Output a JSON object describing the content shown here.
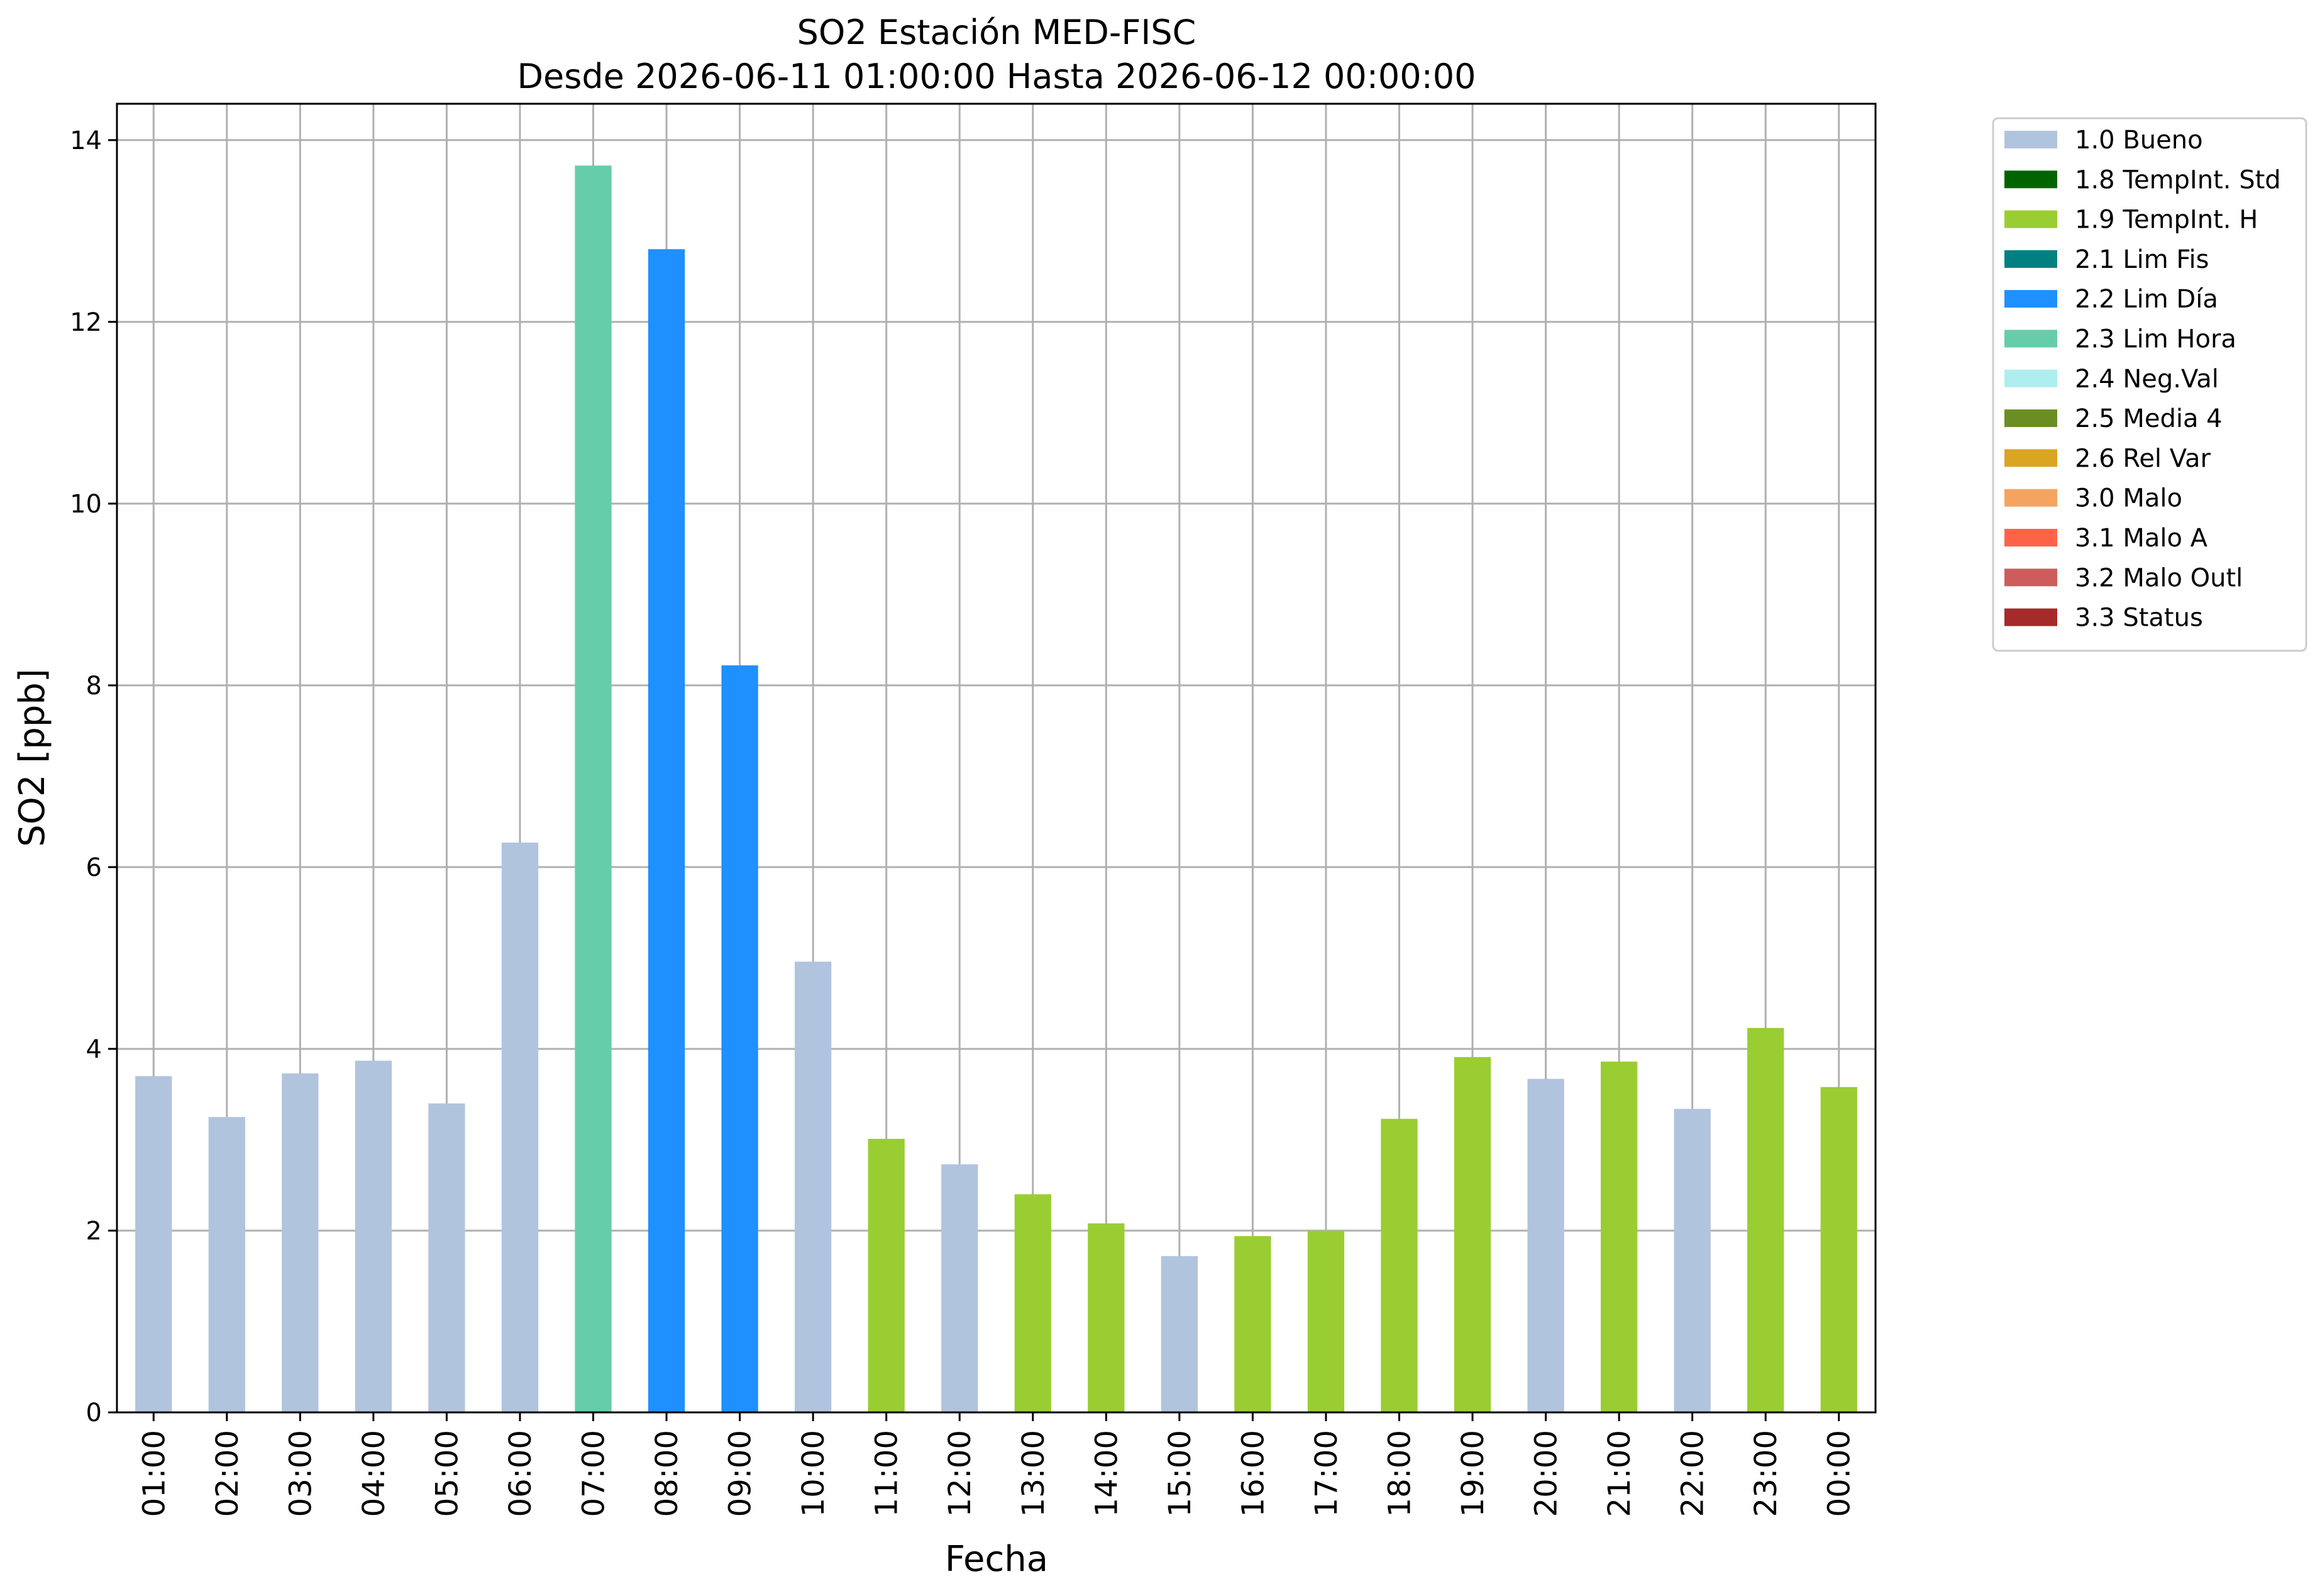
{
  "chart_data": {
    "type": "bar",
    "title_line1": "SO2 Estación MED-FISC",
    "title_line2": "Desde 2026-06-11 01:00:00 Hasta 2026-06-12 00:00:00",
    "xlabel": "Fecha",
    "ylabel": "SO2 [ppb]",
    "ylim": [
      0,
      14.4
    ],
    "yticks": [
      0,
      2,
      4,
      6,
      8,
      10,
      12,
      14
    ],
    "grid": true,
    "legend_position": "outside-right-top",
    "categories": [
      "01:00",
      "02:00",
      "03:00",
      "04:00",
      "05:00",
      "06:00",
      "07:00",
      "08:00",
      "09:00",
      "10:00",
      "11:00",
      "12:00",
      "13:00",
      "14:00",
      "15:00",
      "16:00",
      "17:00",
      "18:00",
      "19:00",
      "20:00",
      "21:00",
      "22:00",
      "23:00",
      "00:00"
    ],
    "values": [
      3.7,
      3.25,
      3.73,
      3.87,
      3.4,
      6.27,
      13.72,
      12.8,
      8.22,
      4.96,
      3.01,
      2.73,
      2.4,
      2.08,
      1.72,
      1.94,
      2.0,
      3.23,
      3.91,
      3.67,
      3.86,
      3.34,
      4.23,
      3.58
    ],
    "flags": [
      "1.0 Bueno",
      "1.0 Bueno",
      "1.0 Bueno",
      "1.0 Bueno",
      "1.0 Bueno",
      "1.0 Bueno",
      "2.3 Lim Hora",
      "2.2 Lim Día",
      "2.2 Lim Día",
      "1.0 Bueno",
      "1.9 TempInt. H",
      "1.0 Bueno",
      "1.9 TempInt. H",
      "1.9 TempInt. H",
      "1.0 Bueno",
      "1.9 TempInt. H",
      "1.9 TempInt. H",
      "1.9 TempInt. H",
      "1.9 TempInt. H",
      "1.0 Bueno",
      "1.9 TempInt. H",
      "1.0 Bueno",
      "1.9 TempInt. H",
      "1.9 TempInt. H"
    ],
    "legend": [
      {
        "label": "1.0 Bueno",
        "color": "#b0c4de"
      },
      {
        "label": "1.8 TempInt. Std",
        "color": "#006400"
      },
      {
        "label": "1.9 TempInt. H",
        "color": "#9acd32"
      },
      {
        "label": "2.1 Lim Fis",
        "color": "#008080"
      },
      {
        "label": "2.2 Lim Día",
        "color": "#1e90ff"
      },
      {
        "label": "2.3 Lim Hora",
        "color": "#66cdaa"
      },
      {
        "label": "2.4 Neg.Val",
        "color": "#afeeee"
      },
      {
        "label": "2.5 Media 4",
        "color": "#6b8e23"
      },
      {
        "label": "2.6 Rel Var",
        "color": "#daa520"
      },
      {
        "label": "3.0 Malo",
        "color": "#f4a460"
      },
      {
        "label": "3.1 Malo A",
        "color": "#ff6347"
      },
      {
        "label": "3.2 Malo Outl",
        "color": "#cd5c5c"
      },
      {
        "label": "3.3 Status",
        "color": "#a52a2a"
      }
    ]
  }
}
